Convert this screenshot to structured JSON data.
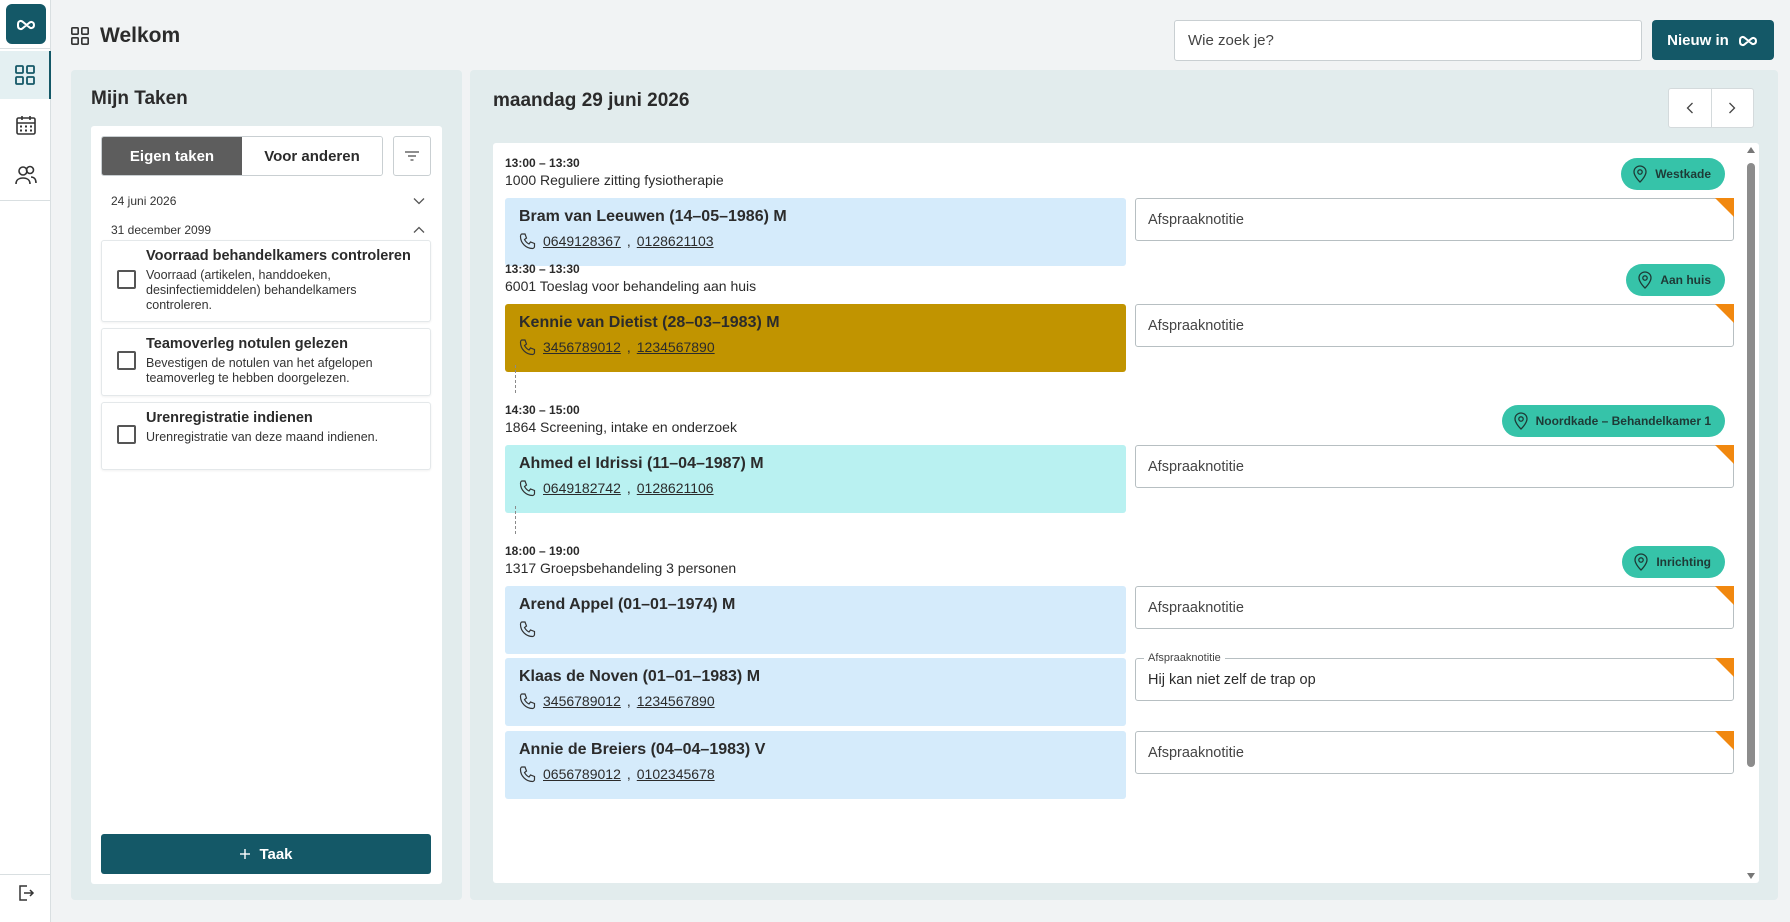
{
  "header": {
    "title": "Welkom",
    "search_placeholder": "Wie zoek je?",
    "new_label": "Nieuw in"
  },
  "tasks": {
    "title": "Mijn Taken",
    "tab_own": "Eigen taken",
    "tab_others": "Voor anderen",
    "dates": [
      "24 juni 2026",
      "31 december 2099"
    ],
    "items": [
      {
        "title": "Voorraad behandelkamers controleren",
        "desc": "Voorraad (artikelen, handdoeken, desinfectiemiddelen) behandelkamers controleren."
      },
      {
        "title": "Teamoverleg notulen gelezen",
        "desc": "Bevestigen de notulen van het afgelopen teamoverleg te hebben doorgelezen."
      },
      {
        "title": "Urenregistratie indienen",
        "desc": "Urenregistratie van deze maand indienen."
      }
    ],
    "add_label": "Taak"
  },
  "schedule": {
    "date_title": "maandag 29 juni 2026",
    "note_placeholder": "Afspraaknotitie",
    "slots": [
      {
        "time": "13:00 – 13:30",
        "desc": "1000 Reguliere zitting fysiotherapie",
        "location": "Westkade"
      },
      {
        "time": "13:30 – 13:30",
        "desc": "6001 Toeslag voor behandeling aan huis",
        "location": "Aan huis"
      },
      {
        "time": "14:30 – 15:00",
        "desc": "1864 Screening, intake en onderzoek",
        "location": "Noordkade – Behandelkamer 1"
      },
      {
        "time": "18:00 – 19:00",
        "desc": "1317 Groepsbehandeling 3 personen",
        "location": "Inrichting"
      }
    ],
    "patients": [
      {
        "name": "Bram van Leeuwen (14–05–1986) M",
        "phone1": "0649128367",
        "phone2": "0128621103",
        "color": "#d5ebfb"
      },
      {
        "name": "Kennie van Dietist (28–03–1983) M",
        "phone1": "3456789012",
        "phone2": "1234567890",
        "color": "#c19400"
      },
      {
        "name": "Ahmed el Idrissi (11–04–1987) M",
        "phone1": "0649182742",
        "phone2": "0128621106",
        "color": "#b9f1f1"
      },
      {
        "name": "Arend Appel (01–01–1974) M",
        "phone1": "",
        "phone2": "",
        "color": "#d5ebfb"
      },
      {
        "name": "Klaas de Noven (01–01–1983) M",
        "phone1": "3456789012",
        "phone2": "1234567890",
        "color": "#d5ebfb",
        "note_label": "Afspraaknotitie",
        "note": "Hij kan niet zelf de trap op"
      },
      {
        "name": "Annie de Breiers (04–04–1983) V",
        "phone1": "0656789012",
        "phone2": "0102345678",
        "color": "#d5ebfb"
      }
    ]
  },
  "colors": {
    "primary": "#145867",
    "location_badge": "#36c3a9",
    "note_corner": "#f1880f"
  }
}
